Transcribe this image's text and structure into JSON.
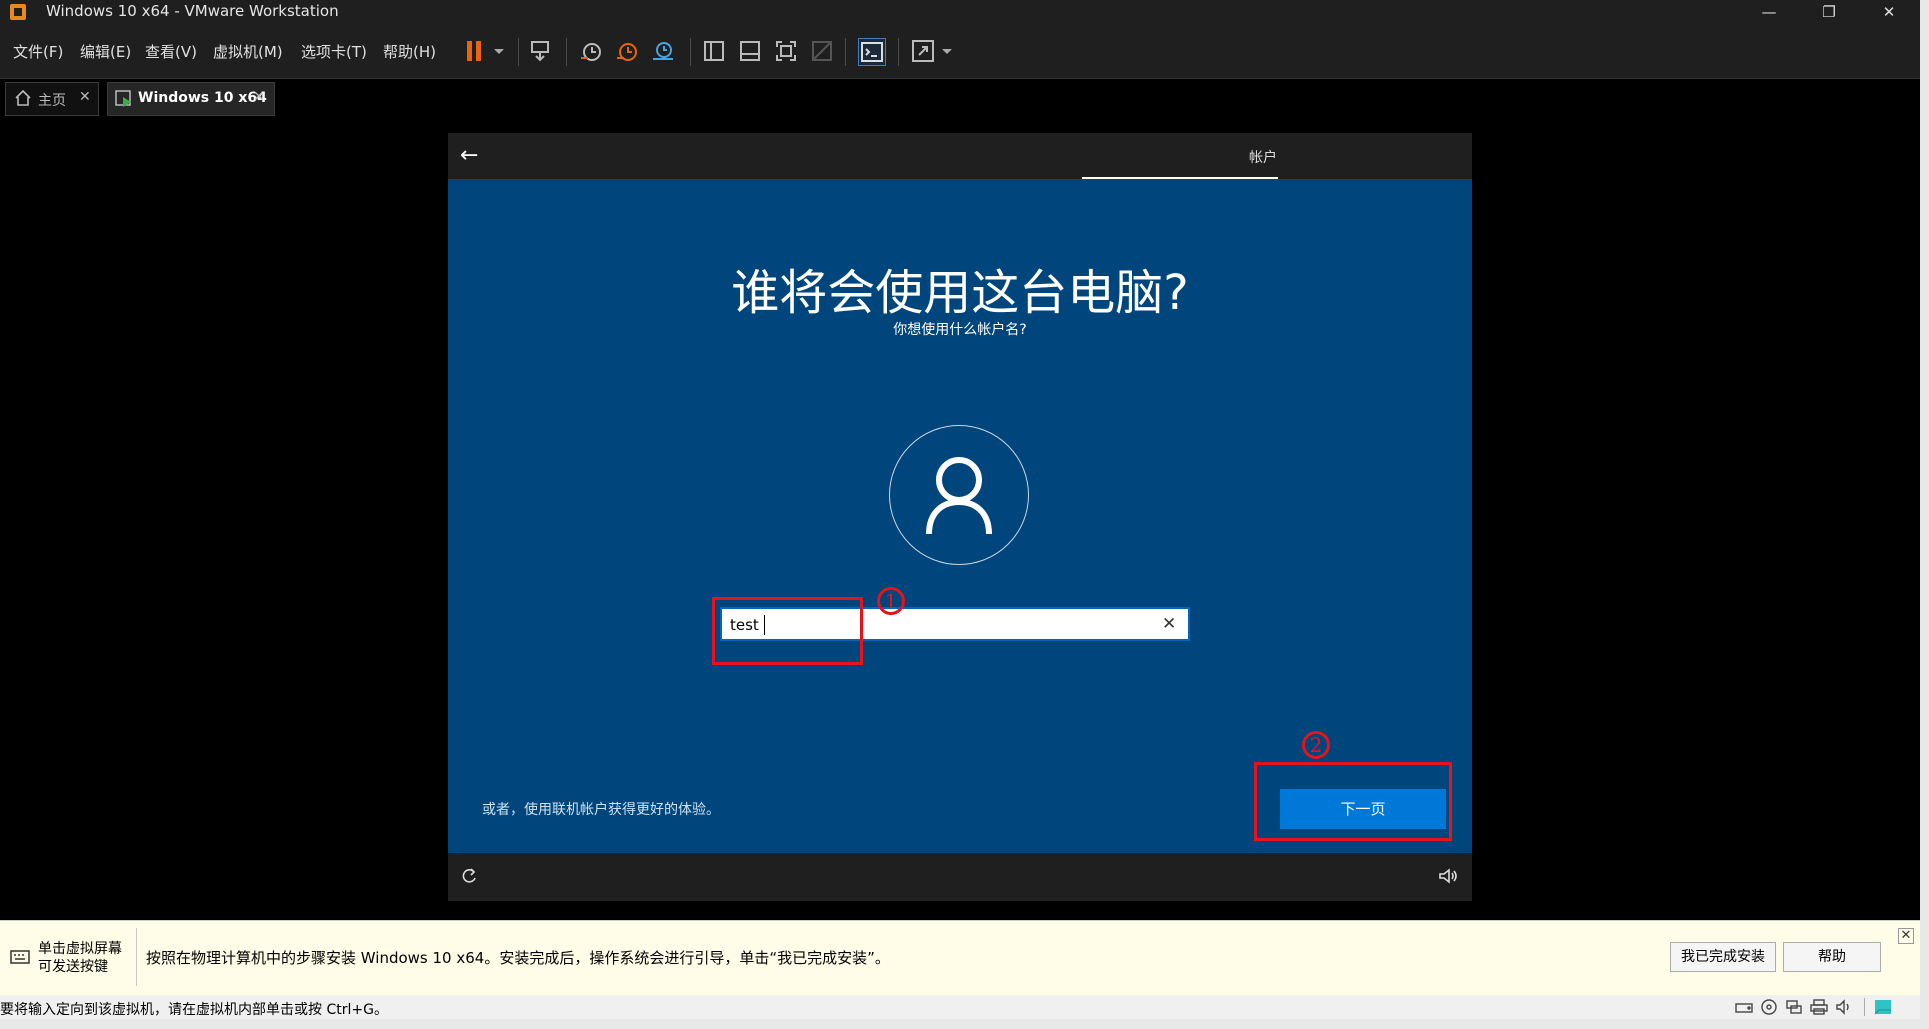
{
  "window": {
    "title": "Windows 10 x64 - VMware Workstation",
    "minimize": "—",
    "restore": "❐",
    "close": "✕"
  },
  "menu": {
    "items": [
      "文件(F)",
      "编辑(E)",
      "查看(V)",
      "虚拟机(M)",
      "选项卡(T)",
      "帮助(H)"
    ]
  },
  "toolbar": {
    "pause_color": "#e8650e",
    "icons": [
      "pause-icon",
      "send-ctrl-alt-del-icon",
      "snapshot-icon",
      "revert-snapshot-icon",
      "snapshot-manager-icon",
      "library-icon",
      "thumbnail-icon",
      "full-screen-icon",
      "unity-icon",
      "console-icon",
      "stretch-icon"
    ]
  },
  "tabs": [
    {
      "label": "主页",
      "close": "✕"
    },
    {
      "label": "Windows 10 x64",
      "close": "✕"
    }
  ],
  "vm": {
    "back": "←",
    "tab_label": "帐户",
    "heading": "谁将会使用这台电脑?",
    "subheading": "你想使用什么帐户名?",
    "name_value": "test",
    "clear": "✕",
    "online_link": "或者，使用联机帐户获得更好的体验。",
    "next_button": "下一页",
    "background": "#00457c",
    "accent": "#0078d7"
  },
  "annotations": {
    "step1": "1",
    "step2": "2",
    "color": "#e3141b"
  },
  "infobar": {
    "hint_line1": "单击虚拟屏幕",
    "hint_line2": "可发送按键",
    "message": "按照在物理计算机中的步骤安装 Windows 10 x64。安装完成后，操作系统会进行引导，单击“我已完成安装”。",
    "done_button": "我已完成安装",
    "help_button": "帮助",
    "close": "✕"
  },
  "statusbar": {
    "text": "要将输入定向到该虚拟机，请在虚拟机内部单击或按 Ctrl+G。"
  }
}
